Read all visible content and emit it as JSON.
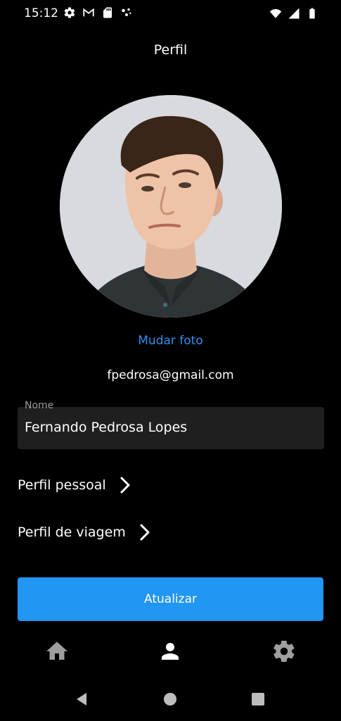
{
  "status_bar": {
    "time": "15:12",
    "left_icons": [
      "settings-icon",
      "gmail-icon",
      "sd-card-icon",
      "dots-icon"
    ],
    "right_icons": [
      "wifi-icon",
      "signal-icon",
      "battery-icon"
    ]
  },
  "app_bar": {
    "title": "Perfil"
  },
  "profile": {
    "change_photo_label": "Mudar foto",
    "email": "fpedrosa@gmail.com"
  },
  "name_field": {
    "label": "Nome",
    "value": "Fernando Pedrosa Lopes"
  },
  "menu": [
    {
      "label": "Perfil pessoal",
      "icon": "chevron-right-icon"
    },
    {
      "label": "Perfil de viagem",
      "icon": "chevron-right-icon"
    }
  ],
  "update_button": {
    "label": "Atualizar"
  },
  "bottom_nav": {
    "items": [
      {
        "icon": "home-icon",
        "active": false
      },
      {
        "icon": "person-icon",
        "active": true
      },
      {
        "icon": "settings-icon",
        "active": false
      }
    ],
    "active_color": "#ffffff",
    "inactive_color": "#9e9e9e"
  },
  "colors": {
    "background": "#000000",
    "accent": "#2196f3",
    "link": "#2f8ff0",
    "field_background": "#1f1f1f"
  }
}
